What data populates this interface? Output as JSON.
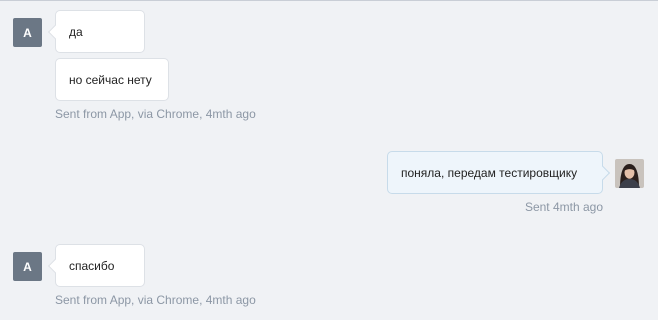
{
  "conversation": {
    "messages": [
      {
        "author_initial": "A",
        "direction": "incoming",
        "bubbles": [
          "да",
          "но сейчас нету"
        ],
        "meta": "Sent from App, via Chrome, 4mth ago"
      },
      {
        "direction": "outgoing",
        "bubbles": [
          "поняла, передам тестировщику"
        ],
        "meta": "Sent 4mth ago",
        "avatar_icon": "agent-photo"
      },
      {
        "author_initial": "A",
        "direction": "incoming",
        "bubbles": [
          "спасибо"
        ],
        "meta": "Sent from App, via Chrome, 4mth ago"
      }
    ]
  },
  "colors": {
    "background": "#f0f2f5",
    "avatar_bg": "#6b7785",
    "meta_text": "#8c97a5",
    "incoming_bubble": "#ffffff",
    "outgoing_bubble": "#eef5fb"
  }
}
